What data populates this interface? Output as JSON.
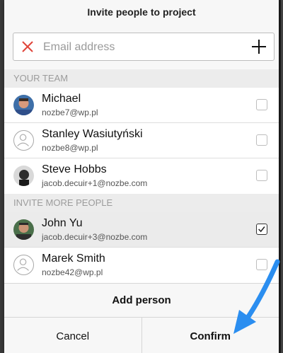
{
  "dialog": {
    "title": "Invite people to project",
    "email_placeholder": "Email address",
    "section_team": "YOUR TEAM",
    "section_invite": "INVITE MORE PEOPLE",
    "add_person": "Add person",
    "cancel": "Cancel",
    "confirm": "Confirm"
  },
  "team": [
    {
      "name": "Michael",
      "email": "nozbe7@wp.pl",
      "checked": false,
      "avatar": "photo"
    },
    {
      "name": "Stanley Wasiutyński",
      "email": "nozbe8@wp.pl",
      "checked": false,
      "avatar": "placeholder"
    },
    {
      "name": "Steve Hobbs",
      "email": "jacob.decuir+1@nozbe.com",
      "checked": false,
      "avatar": "photo"
    }
  ],
  "invite": [
    {
      "name": "John Yu",
      "email": "jacob.decuir+3@nozbe.com",
      "checked": true,
      "avatar": "photo"
    },
    {
      "name": "Marek Smith",
      "email": "nozbe42@wp.pl",
      "checked": false,
      "avatar": "placeholder"
    }
  ],
  "colors": {
    "accent_red": "#e0453a",
    "arrow_blue": "#2b8ef0"
  },
  "icons": [
    "close-icon",
    "plus-icon",
    "user-placeholder-icon",
    "checkbox-icon",
    "arrow-pointer-icon"
  ]
}
